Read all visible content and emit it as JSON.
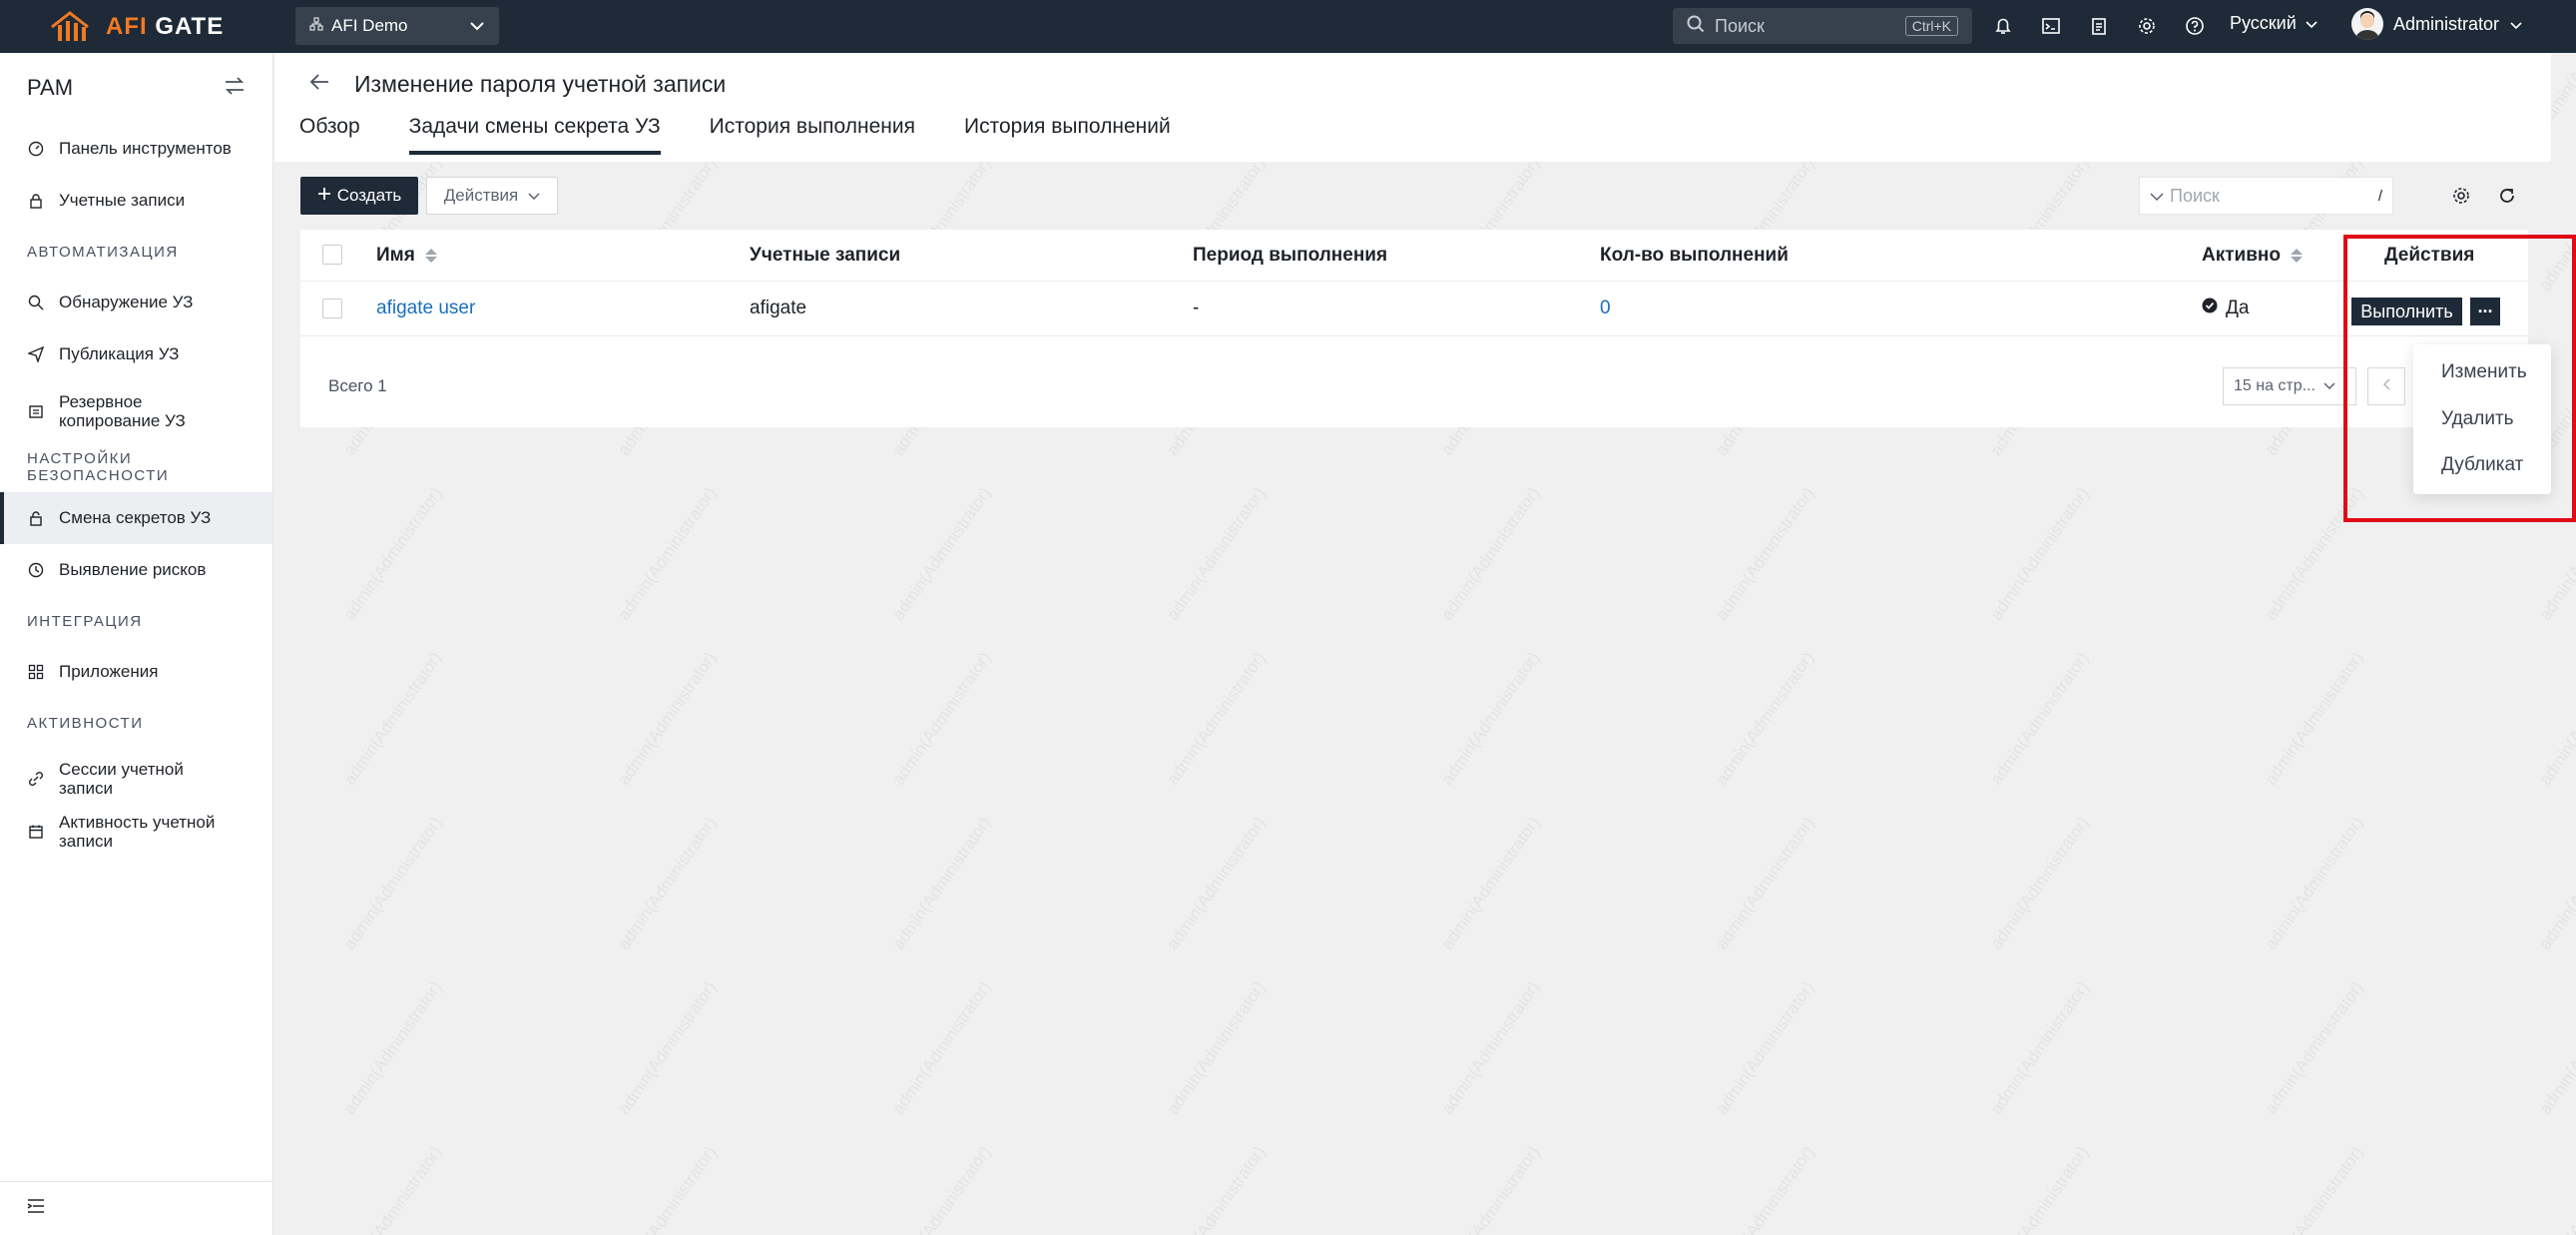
{
  "app": {
    "logo_text": "AFI GATE",
    "tenant": "AFI Demo",
    "search_placeholder": "Поиск",
    "search_shortcut": "Ctrl+K",
    "language": "Русский",
    "user_name": "Administrator"
  },
  "sidebar": {
    "title": "PAM",
    "items": [
      {
        "label": "Панель инструментов",
        "icon": "dashboard-icon"
      },
      {
        "label": "Учетные записи",
        "icon": "lock-icon"
      }
    ],
    "sections": [
      {
        "title": "АВТОМАТИЗАЦИЯ",
        "items": [
          {
            "label": "Обнаружение УЗ",
            "icon": "search-icon"
          },
          {
            "label": "Публикация УЗ",
            "icon": "send-icon"
          },
          {
            "label": "Резервное копирование УЗ",
            "icon": "backup-icon"
          }
        ]
      },
      {
        "title": "НАСТРОЙКИ БЕЗОПАСНОСТИ",
        "items": [
          {
            "label": "Смена секретов УЗ",
            "icon": "secret-change-icon",
            "active": true
          },
          {
            "label": "Выявление рисков",
            "icon": "risk-icon"
          }
        ]
      },
      {
        "title": "ИНТЕГРАЦИЯ",
        "items": [
          {
            "label": "Приложения",
            "icon": "apps-icon"
          }
        ]
      },
      {
        "title": "АКТИВНОСТИ",
        "items": [
          {
            "label": "Сессии учетной записи",
            "icon": "link-icon"
          },
          {
            "label": "Активность учетной записи",
            "icon": "calendar-icon"
          }
        ]
      }
    ]
  },
  "page": {
    "title": "Изменение пароля учетной записи",
    "tabs": [
      "Обзор",
      "Задачи смены секрета УЗ",
      "История выполнения",
      "История выполнений"
    ],
    "active_tab": 1
  },
  "toolbar": {
    "create_label": "Создать",
    "actions_label": "Действия",
    "search_placeholder": "Поиск",
    "search_shortcut": "/"
  },
  "table": {
    "columns": [
      "Имя",
      "Учетные записи",
      "Период выполнения",
      "Кол-во выполнений",
      "Активно",
      "Действия"
    ],
    "rows": [
      {
        "name": "afigate user",
        "accounts": "afigate",
        "period": "-",
        "count": "0",
        "active": "Да",
        "run_label": "Выполнить",
        "more_label": "···"
      }
    ],
    "total": "Всего 1",
    "page_size": "15 на стр..."
  },
  "row_menu": {
    "items": [
      "Изменить",
      "Удалить",
      "Дубликат"
    ]
  },
  "watermark_text": "admin(Administrator)",
  "colors": {
    "topbar": "#1e2a38",
    "accent": "#f27a23",
    "link": "#1a6fc0",
    "highlight": "#e10a17"
  }
}
